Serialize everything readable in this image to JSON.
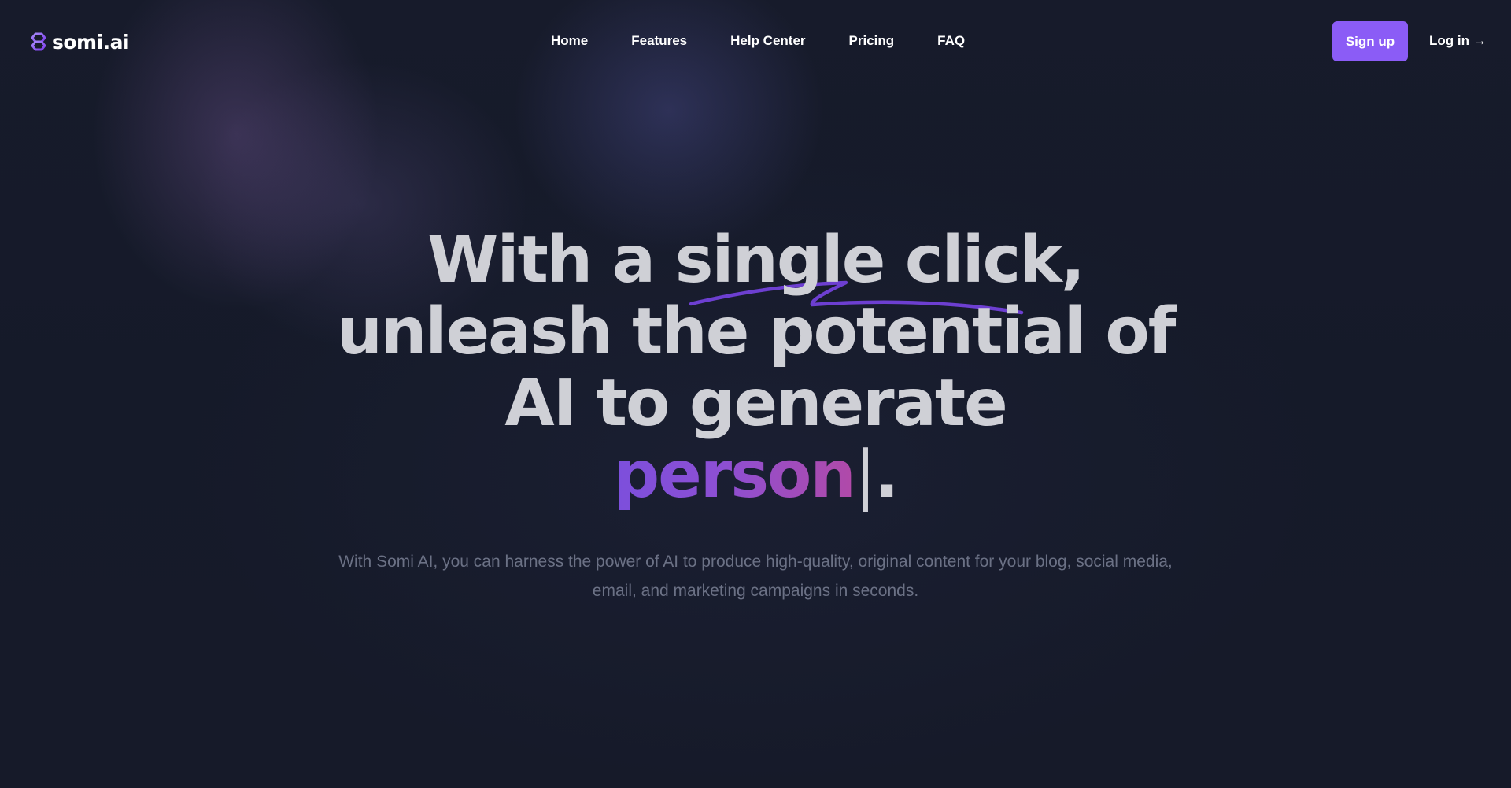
{
  "brand": {
    "name": "somi.ai",
    "logo_icon": "hexagon-link-icon",
    "accent_color": "#8b5cf6"
  },
  "nav": {
    "items": [
      {
        "label": "Home"
      },
      {
        "label": "Features"
      },
      {
        "label": "Help Center"
      },
      {
        "label": "Pricing"
      },
      {
        "label": "FAQ"
      }
    ]
  },
  "header_actions": {
    "signup_label": "Sign up",
    "login_label": "Log in →"
  },
  "hero": {
    "line1": "With a single click,",
    "line2": "unleash the potential of",
    "line3": "AI to generate",
    "typed_word": "person",
    "cursor": "|",
    "trailing": ".",
    "subtitle": "With Somi AI, you can harness the power of AI to produce high-quality, original content for your blog, social media, email, and marketing campaigns in seconds.",
    "gradient_colors": [
      "#7c4fdc",
      "#b14aa8"
    ],
    "underline_color": "#6d3fd1"
  }
}
